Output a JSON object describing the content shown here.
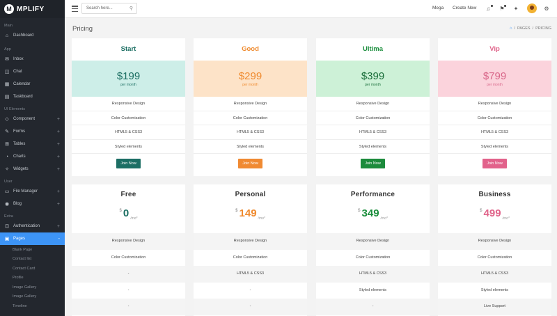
{
  "app": {
    "brand_initial": "M",
    "brand_name": "MPLIFY"
  },
  "sidebar": {
    "sections": {
      "main": "Main",
      "app": "App",
      "ui": "UI Elements",
      "user": "User",
      "extra": "Extra"
    },
    "items": {
      "dashboard": "Dashboard",
      "inbox": "Inbox",
      "chat": "Chat",
      "calendar": "Calendar",
      "taskboard": "Taskboard",
      "component": "Component",
      "forms": "Forms",
      "tables": "Tables",
      "charts": "Charts",
      "widgets": "Widgets",
      "file_manager": "File Manager",
      "blog": "Blog",
      "authentication": "Authentication",
      "pages": "Pages"
    },
    "subitems": [
      "Blank Page",
      "Contact list",
      "Contact Card",
      "Profile",
      "Image Gallery",
      "Image Gallery",
      "Timeline"
    ],
    "plus": "+",
    "active_color": "#3d94f6"
  },
  "topbar": {
    "search_placeholder": "Search here...",
    "mega": "Mega",
    "create_new": "Create New"
  },
  "page": {
    "title": "Pricing",
    "breadcrumb": [
      "PAGES",
      "PRICING"
    ],
    "sep": "/"
  },
  "row1": {
    "per_month": "per month",
    "features": [
      "Responsive Design",
      "Color Customization",
      "HTML5 & CSS3",
      "Styled elements"
    ],
    "button": "Join Now",
    "plans": [
      {
        "name": "Start",
        "price": "$199",
        "color": "#1b6e62",
        "band": "#cdeee8",
        "btn": "#1c6e64"
      },
      {
        "name": "Good",
        "price": "$299",
        "color": "#ef8a2e",
        "band": "#fde3c8",
        "btn": "#f08a32"
      },
      {
        "name": "Ultima",
        "price": "$399",
        "color": "#1a8e3c",
        "band": "#cdf1d7",
        "btn": "#1c8b3c"
      },
      {
        "name": "Vip",
        "price": "$799",
        "color": "#e0648a",
        "band": "#fbd3dc",
        "btn": "#e2628b"
      }
    ]
  },
  "row2": {
    "currency": "$",
    "period": "/mo*",
    "plans": [
      {
        "name": "Free",
        "amount": "0",
        "color": "#1b6e62",
        "features": [
          "Responsive Design",
          "Color Customization",
          "-",
          "-",
          "-"
        ]
      },
      {
        "name": "Personal",
        "amount": "149",
        "color": "#ef8a2e",
        "features": [
          "Responsive Design",
          "Color Customization",
          "HTML5 & CSS3",
          "-",
          "-"
        ]
      },
      {
        "name": "Performance",
        "amount": "349",
        "color": "#1a8e3c",
        "features": [
          "Responsive Design",
          "Color Customization",
          "HTML5 & CSS3",
          "Styled elements",
          "-"
        ]
      },
      {
        "name": "Business",
        "amount": "499",
        "color": "#e0648a",
        "features": [
          "Responsive Design",
          "Color Customization",
          "HTML5 & CSS3",
          "Styled elements",
          "Live Support"
        ]
      }
    ]
  }
}
